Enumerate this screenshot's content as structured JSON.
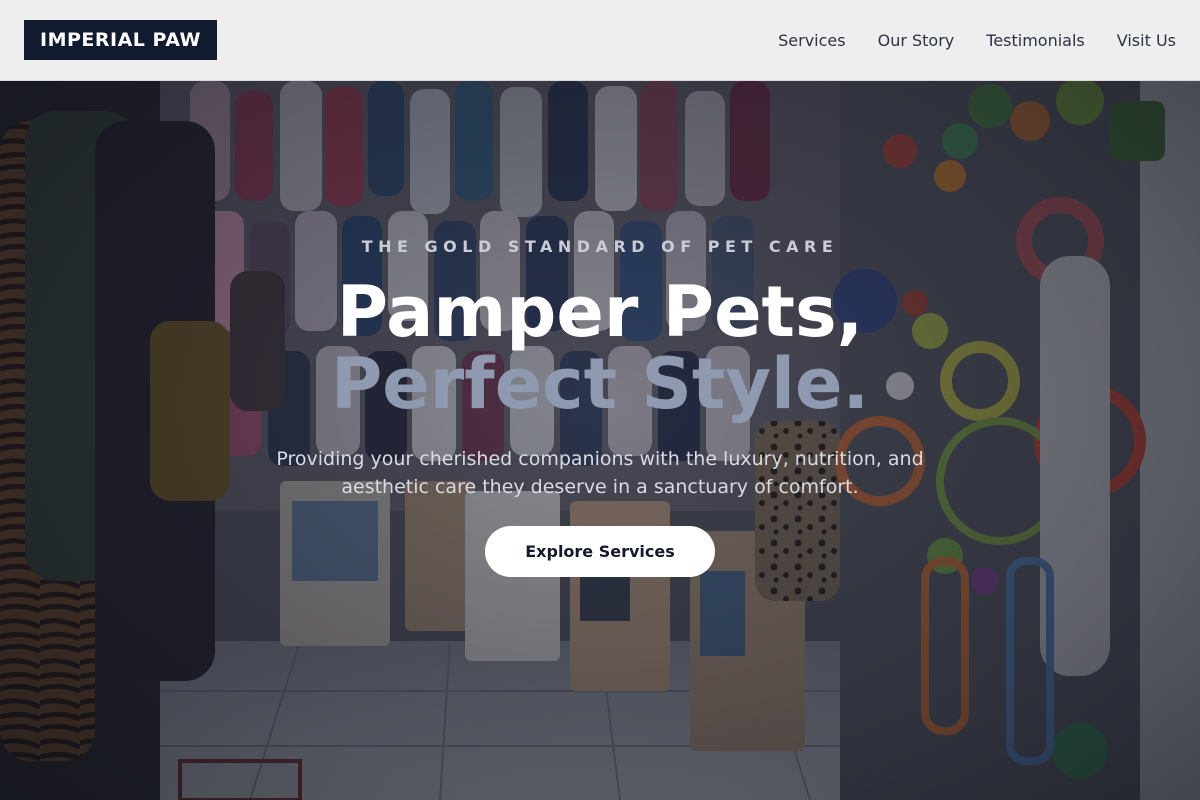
{
  "brand": {
    "logo_text": "IMPERIAL PAW"
  },
  "nav": {
    "items": [
      {
        "label": "Services"
      },
      {
        "label": "Our Story"
      },
      {
        "label": "Testimonials"
      },
      {
        "label": "Visit Us"
      }
    ]
  },
  "hero": {
    "eyebrow": "THE GOLD STANDARD OF PET CARE",
    "headline_line1": "Pamper Pets,",
    "headline_line2": "Perfect Style.",
    "subtext": "Providing your cherished companions with the luxury, nutrition, and aesthetic care they deserve in a sanctuary of comfort.",
    "cta_label": "Explore Services",
    "background_image": "pet-shop-interior-photo"
  },
  "colors": {
    "header_bg": "#eeeeef",
    "logo_bg": "#111a2f",
    "headline_white": "#ffffff",
    "headline_muted": "#8f9ab0",
    "cta_bg": "#ffffff",
    "cta_text": "#141a2b"
  }
}
